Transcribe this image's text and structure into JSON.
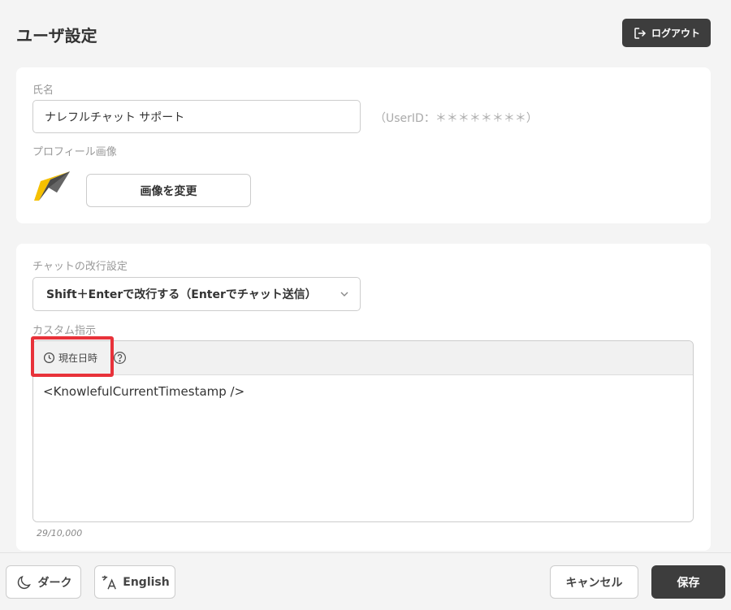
{
  "header": {
    "title": "ユーザ設定",
    "logout_label": "ログアウト"
  },
  "profile": {
    "name_label": "氏名",
    "name_value": "ナレフルチャット サポート",
    "userid_text": "（UserID：＊＊＊＊＊＊＊＊）",
    "image_label": "プロフィール画像",
    "change_image_label": "画像を変更"
  },
  "chat": {
    "newline_label": "チャットの改行設定",
    "newline_selected": "Shift＋Enterで改行する（Enterでチャット送信）",
    "custom_label": "カスタム指示",
    "toolbar_timestamp_label": "現在日時",
    "editor_text": "<KnowlefulCurrentTimestamp />",
    "char_count": "29/10,000"
  },
  "footer": {
    "dark_label": "ダーク",
    "language_label": "English",
    "cancel_label": "キャンセル",
    "save_label": "保存"
  },
  "colors": {
    "primary_dark": "#3d3d3d",
    "highlight": "#e8323a",
    "logo_yellow": "#f5c000"
  }
}
